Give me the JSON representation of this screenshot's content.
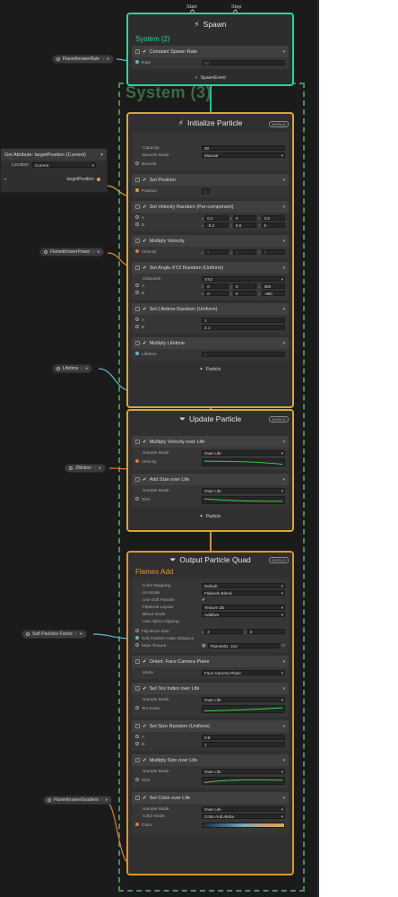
{
  "spawn": {
    "start_label": "Start",
    "stop_label": "Stop",
    "title": "Spawn",
    "system_name": "System (2)",
    "block": {
      "title": "Constant Spawn Rate",
      "rate_label": "Rate",
      "rate_value": "64"
    },
    "footer": "SpawnEvent"
  },
  "system3_title": "System (3)",
  "left_nodes": {
    "flamethrower_rate": "FlamethrowerRate",
    "flamethrower_power": "FlamethrowerPower",
    "lifetime": "Lifetime",
    "zmotion": "ZMotion",
    "soft_particles_factor": "Soft Particles Factor",
    "flamethrower_gradient": "FlamethrowerGradient"
  },
  "get_attribute": {
    "title": "Get Attribute: targetPosition (Current)",
    "location_label": "Location",
    "location_value": "Current",
    "output_label": "targetPosition"
  },
  "initialize": {
    "title": "Initialize Particle",
    "badge": "WORLD",
    "capacity_label": "Capacity",
    "capacity_value": "30",
    "bounds_mode_label": "Bounds Mode",
    "bounds_mode_value": "Manual",
    "bounds_label": "Bounds",
    "set_position": {
      "title": "Set Position",
      "position_label": "Position",
      "position_value": "L"
    },
    "set_velocity": {
      "title": "Set Velocity Random (Per-component)",
      "a_label": "A",
      "b_label": "B",
      "a": {
        "x": "0.2",
        "y": "0",
        "z": "3.5"
      },
      "b": {
        "x": "-0.2",
        "y": "0.6",
        "z": "5"
      }
    },
    "multiply_velocity": {
      "title": "Multiply Velocity",
      "velocity_label": "Velocity",
      "x": "1",
      "y": "1",
      "z": "1"
    },
    "set_angle": {
      "title": "Set Angle.XYZ Random (Uniform)",
      "channels_label": "Channels",
      "channels_value": "XYZ",
      "a_label": "A",
      "b_label": "B",
      "a": {
        "x": "0",
        "y": "0",
        "z": "360"
      },
      "b": {
        "x": "0",
        "y": "0",
        "z": "-360"
      }
    },
    "set_lifetime": {
      "title": "Set Lifetime Random (Uniform)",
      "a_label": "A",
      "a_value": "1",
      "b_label": "B",
      "b_value": "2.1"
    },
    "multiply_lifetime": {
      "title": "Multiply Lifetime",
      "lifetime_label": "Lifetime",
      "lifetime_value": "1"
    },
    "footer": "Particle"
  },
  "update": {
    "title": "Update Particle",
    "badge": "WORLD",
    "multiply_velocity_life": {
      "title": "Multiply Velocity over Life",
      "sample_mode_label": "Sample Mode",
      "sample_mode_value": "Over Life",
      "velocity_label": "Velocity"
    },
    "add_size_life": {
      "title": "Add Size over Life",
      "sample_mode_label": "Sample Mode",
      "sample_mode_value": "Over Life",
      "size_label": "Size"
    },
    "footer": "Particle"
  },
  "output": {
    "title": "Output Particle Quad",
    "badge": "WORLD",
    "subtitle": "Flames Add",
    "settings": [
      {
        "label": "Color Mapping",
        "value": "Default",
        "type": "dropdown"
      },
      {
        "label": "Uv Mode",
        "value": "Flipbook Blend",
        "type": "dropdown"
      },
      {
        "label": "Use Soft Particle",
        "value": "✔",
        "type": "check"
      },
      {
        "label": "Flipbook Layout",
        "value": "Texture 2D",
        "type": "dropdown"
      },
      {
        "label": "Blend Mode",
        "value": "Additive",
        "type": "dropdown"
      },
      {
        "label": "Use Alpha Clipping",
        "value": "",
        "type": "check"
      }
    ],
    "flipbook_size_label": "Flip Book Size",
    "flipbook_x": "2",
    "flipbook_y": "2",
    "soft_fade_label": "Soft Particle Fade Distance",
    "main_texture_label": "Main Texture",
    "main_texture_value": "Flames01_2x2",
    "orient": {
      "title": "Orient: Face Camera Plane",
      "mode_label": "Mode",
      "mode_value": "Face Camera Plane"
    },
    "tex_index": {
      "title": "Set Tex Index over Life",
      "sample_mode_label": "Sample Mode",
      "sample_mode_value": "Over Life",
      "tex_index_label": "Tex Index"
    },
    "size_random": {
      "title": "Set Size Random (Uniform)",
      "a_label": "A",
      "a_value": "0.8",
      "b_label": "B",
      "b_value": "1"
    },
    "multiply_size": {
      "title": "Multiply Size over Life",
      "sample_mode_label": "Sample Mode",
      "sample_mode_value": "Over Life",
      "size_label": "Size"
    },
    "set_color": {
      "title": "Set Color over Life",
      "sample_mode_label": "Sample Mode",
      "sample_mode_value": "Over Life",
      "color_mode_label": "Color Mode",
      "color_mode_value": "Color And Alpha",
      "color_label": "Color"
    }
  },
  "axis_labels": {
    "x": "x",
    "y": "y",
    "z": "z"
  },
  "chevron": "▾",
  "colors": {
    "spawn_border": "#2ed39b",
    "context_border": "#d9a53b",
    "output_border": "#e0932e",
    "system_dash": "#4f8a58",
    "curve_green": "#3bd34a"
  }
}
